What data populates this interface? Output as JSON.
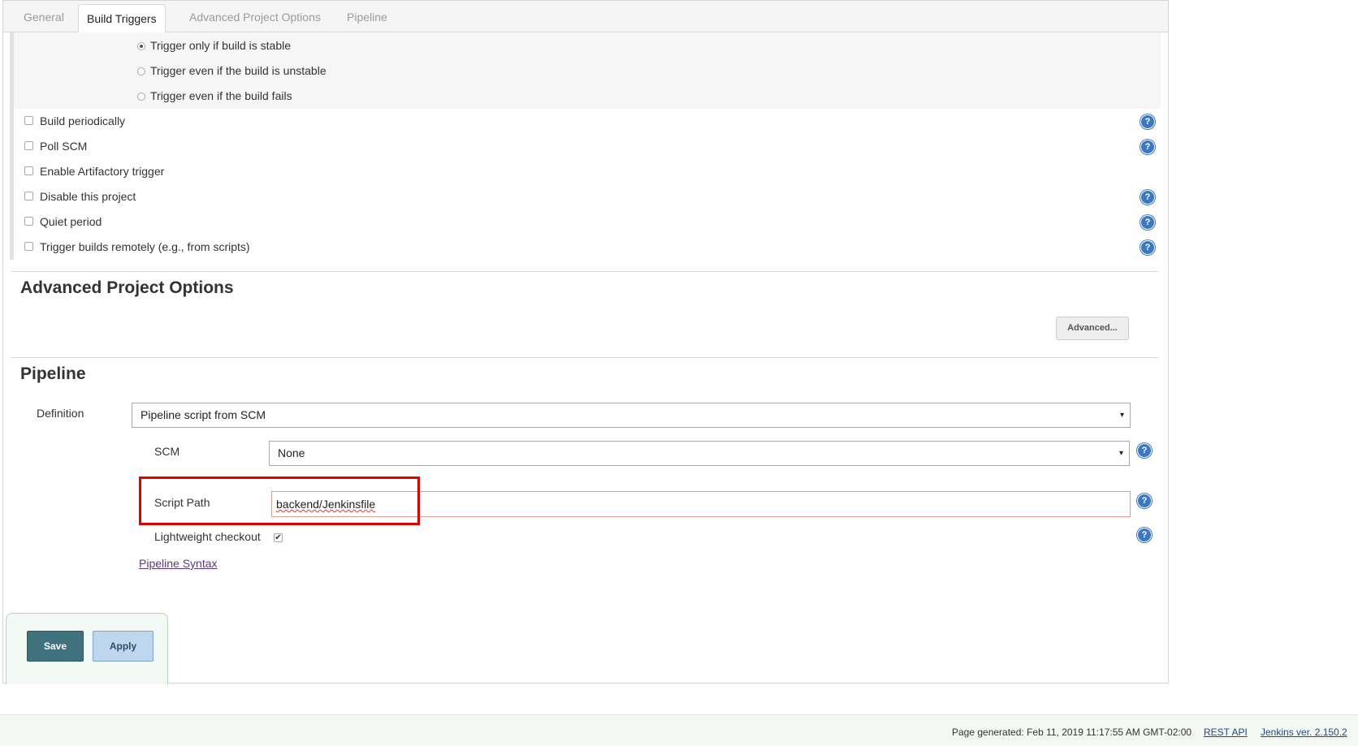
{
  "tabs": [
    {
      "label": "General",
      "active": false
    },
    {
      "label": "Build Triggers",
      "active": true
    },
    {
      "label": "Advanced Project Options",
      "active": false
    },
    {
      "label": "Pipeline",
      "active": false
    }
  ],
  "trigger_threshold": {
    "options": [
      {
        "label": "Trigger only if build is stable",
        "checked": true
      },
      {
        "label": "Trigger even if the build is unstable",
        "checked": false
      },
      {
        "label": "Trigger even if the build fails",
        "checked": false
      }
    ]
  },
  "build_triggers": [
    {
      "label": "Build periodically",
      "checked": false,
      "help": true
    },
    {
      "label": "Poll SCM",
      "checked": false,
      "help": true
    },
    {
      "label": "Enable Artifactory trigger",
      "checked": false,
      "help": false
    },
    {
      "label": "Disable this project",
      "checked": false,
      "help": true
    },
    {
      "label": "Quiet period",
      "checked": false,
      "help": true
    },
    {
      "label": "Trigger builds remotely (e.g., from scripts)",
      "checked": false,
      "help": true
    }
  ],
  "advanced_project_options": {
    "title": "Advanced Project Options",
    "advanced_button": "Advanced..."
  },
  "pipeline": {
    "title": "Pipeline",
    "definition_label": "Definition",
    "definition_value": "Pipeline script from SCM",
    "scm_label": "SCM",
    "scm_value": "None",
    "script_path_label": "Script Path",
    "script_path_value": "backend/Jenkinsfile",
    "lightweight_label": "Lightweight checkout",
    "lightweight_checked": true,
    "syntax_link": "Pipeline Syntax"
  },
  "buttons": {
    "save": "Save",
    "apply": "Apply"
  },
  "footer": {
    "generated": "Page generated: Feb 11, 2019 11:17:55 AM GMT-02:00",
    "rest_api": "REST API",
    "version": "Jenkins ver. 2.150.2"
  },
  "colors": {
    "accent_save": "#40727e",
    "apply": "#bfd7ee",
    "help_icon": "#3b78c4",
    "highlight": "#e00000"
  },
  "icons": {
    "help": "?",
    "dropdown": "▾",
    "checkmark": "✔"
  }
}
